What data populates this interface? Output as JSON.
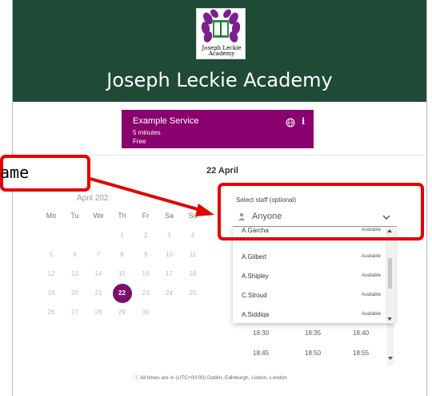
{
  "header": {
    "logo_text": "Joseph Leckie\nAcademy",
    "title": "Joseph Leckie Academy"
  },
  "service": {
    "name": "Example Service",
    "duration": "5 minutes",
    "price": "Free",
    "info": "i"
  },
  "selected_date": "22 April",
  "calendar": {
    "month": "April 202",
    "weekdays": [
      "Mo",
      "Tu",
      "We",
      "Th",
      "Fr",
      "Sa",
      "Su"
    ],
    "weeks": [
      [
        "",
        "",
        "",
        "1",
        "2",
        "3",
        "4"
      ],
      [
        "5",
        "6",
        "7",
        "8",
        "9",
        "10",
        "11"
      ],
      [
        "12",
        "13",
        "14",
        "15",
        "16",
        "17",
        "18"
      ],
      [
        "19",
        "20",
        "21",
        "22",
        "23",
        "24",
        "25"
      ],
      [
        "26",
        "27",
        "28",
        "29",
        "30",
        "",
        ""
      ]
    ],
    "selected_day": "22"
  },
  "staff": {
    "label": "Select staff (optional)",
    "placeholder": "Anyone",
    "options": [
      {
        "name": "A.Garcha",
        "status": "Available"
      },
      {
        "name": "A.Gilbert",
        "status": "Available"
      },
      {
        "name": "A.Shipley",
        "status": "Available"
      },
      {
        "name": "C.Stroud",
        "status": "Available"
      },
      {
        "name": "A.Siddiqa",
        "status": "Available"
      }
    ]
  },
  "time_slots": [
    [
      "18:30",
      "18:35",
      "18:40"
    ],
    [
      "18:45",
      "18:50",
      "18:55"
    ]
  ],
  "footer_note": "All times are in (UTC+00:00) Dublin, Edinburgh, Lisbon, London",
  "annotation": {
    "text": "ame"
  },
  "colors": {
    "header_bg": "#1f4a35",
    "service_bg": "#8a006e",
    "selected_day_bg": "#7b0f6b",
    "annotation": "#e60000"
  }
}
